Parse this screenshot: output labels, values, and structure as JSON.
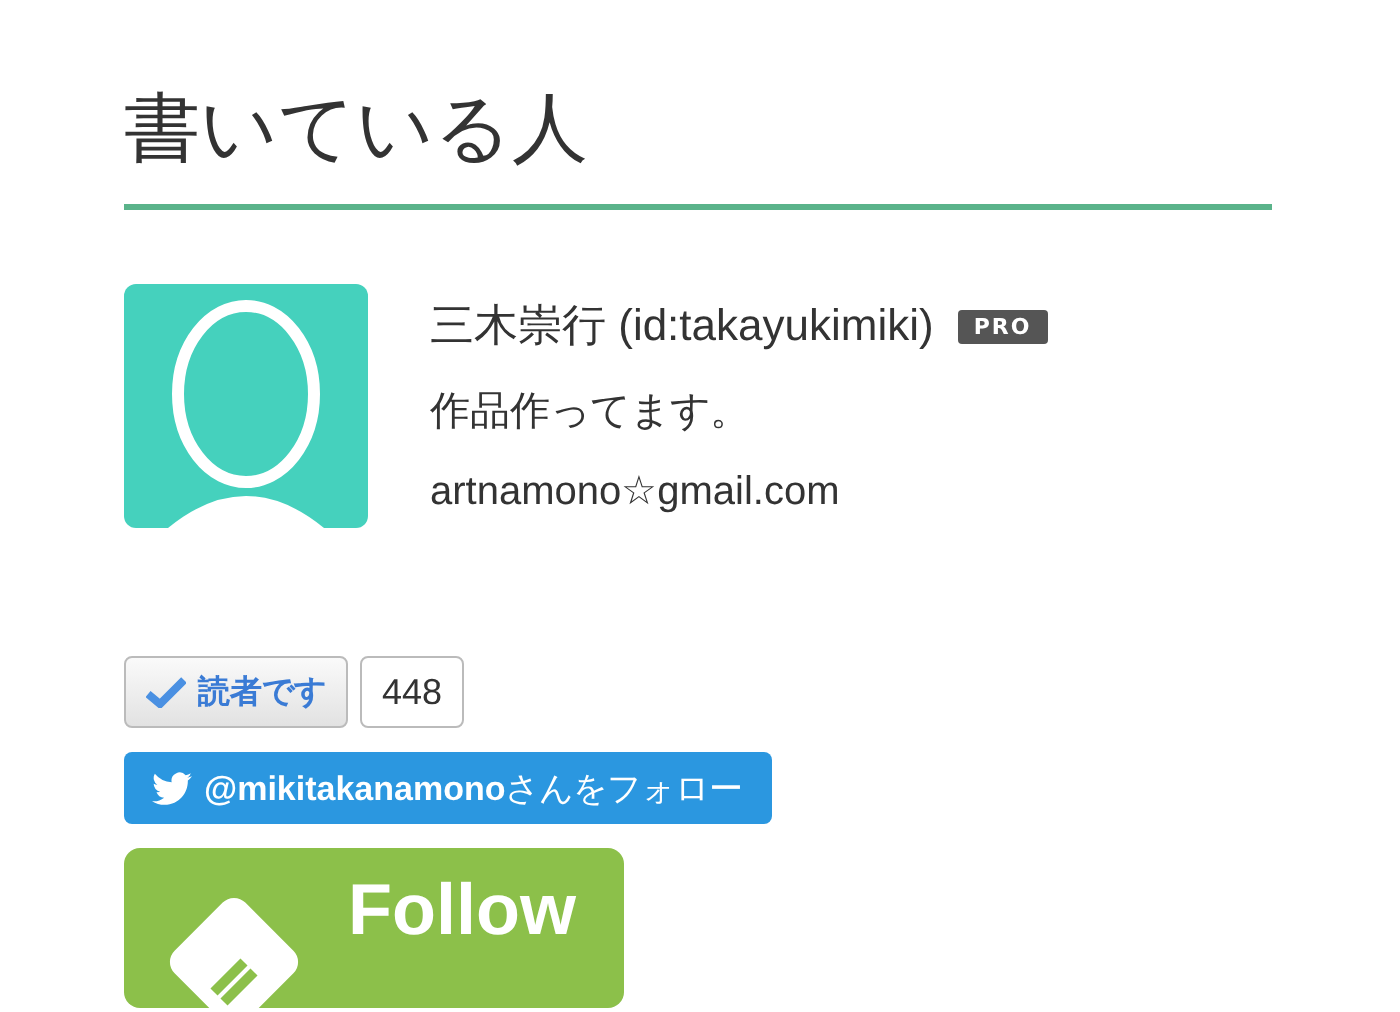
{
  "heading": "書いている人",
  "profile": {
    "name": "三木崇行 (id:takayukimiki)",
    "badge": "PRO",
    "bio": "作品作ってます。",
    "email": "artnamono☆gmail.com"
  },
  "reader_button": {
    "label": "読者です",
    "checked": true,
    "count": "448"
  },
  "twitter_button": {
    "label": "**@mikitakanamono**さんをフォロー"
  },
  "follow_button": {
    "label": "Follow"
  }
}
